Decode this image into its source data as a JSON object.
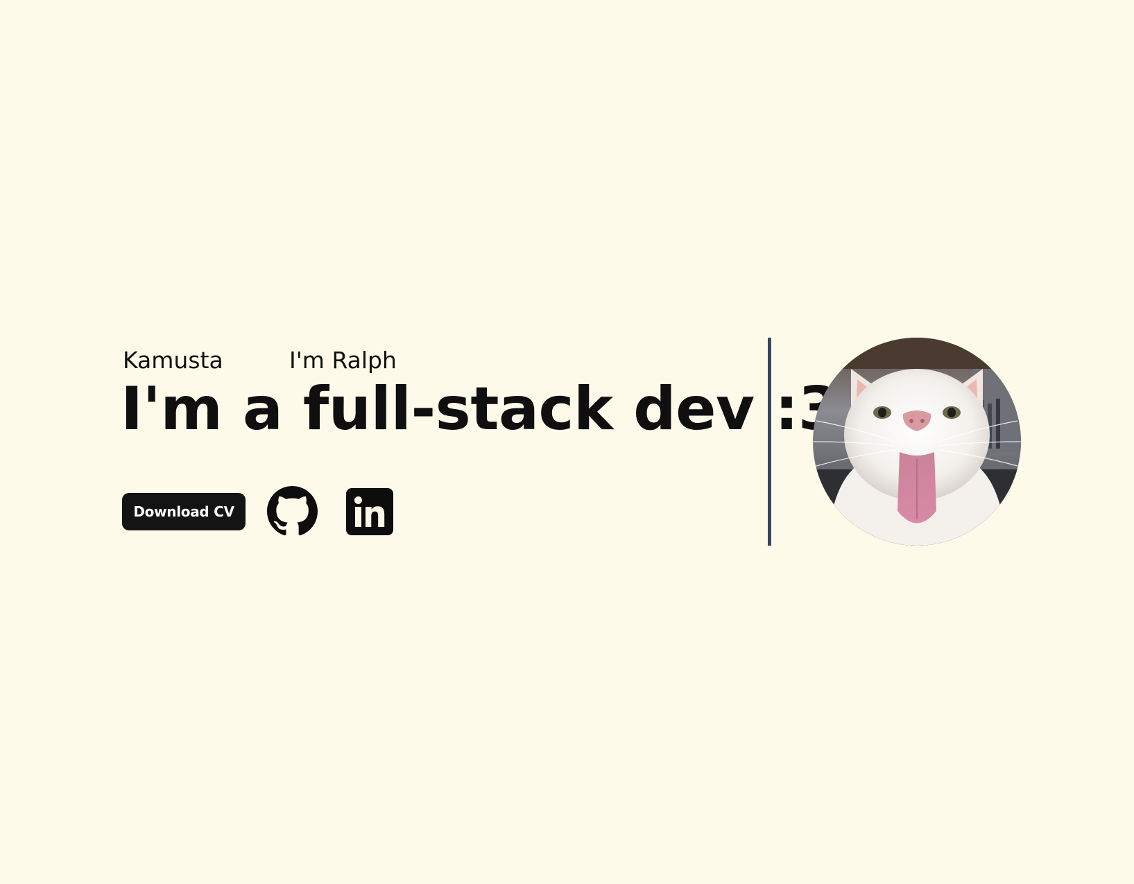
{
  "intro": {
    "name": "Kamusta",
    "greeting": "I'm Ralph"
  },
  "headline": "I'm a full-stack dev :3",
  "actions": {
    "download_label": "Download CV",
    "github_icon": "github-icon",
    "linkedin_icon": "linkedin-icon"
  },
  "avatar": {
    "subject": "white cat sticking out tongue"
  },
  "colors": {
    "background": "#fdfaea",
    "text": "#111111",
    "button": "#141414",
    "divider": "#3b4758"
  }
}
